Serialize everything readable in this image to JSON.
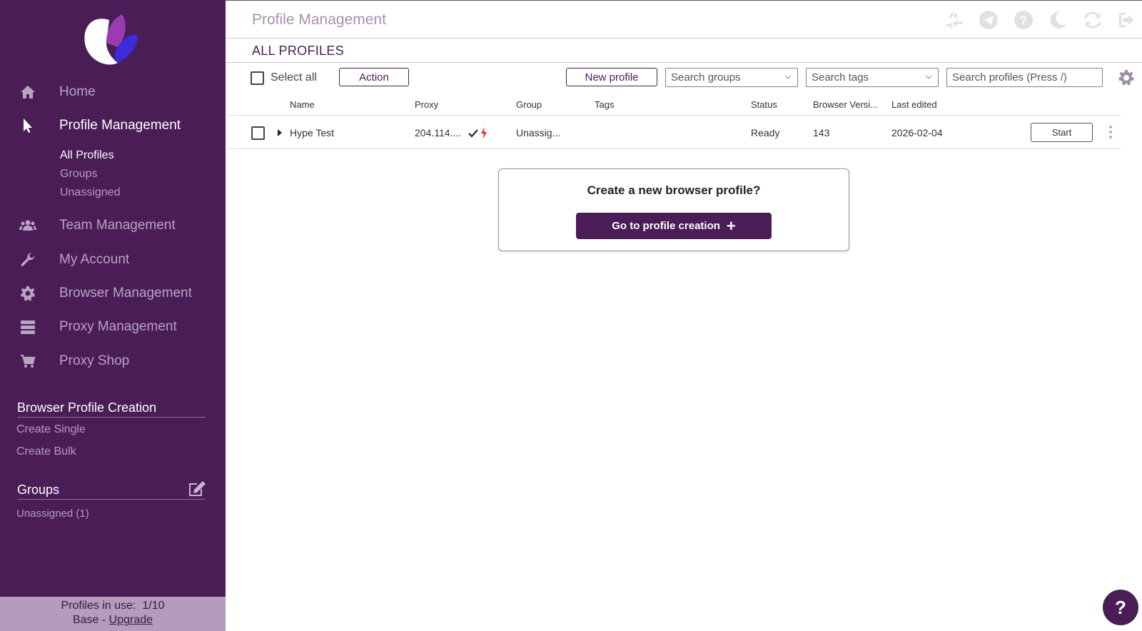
{
  "sidebar": {
    "nav": [
      {
        "label": "Home",
        "icon": "home-icon"
      },
      {
        "label": "Profile Management",
        "icon": "cursor-icon"
      },
      {
        "label": "Team Management",
        "icon": "team-icon"
      },
      {
        "label": "My Account",
        "icon": "wrench-icon"
      },
      {
        "label": "Browser Management",
        "icon": "gear-icon"
      },
      {
        "label": "Proxy Management",
        "icon": "server-icon"
      },
      {
        "label": "Proxy Shop",
        "icon": "cart-icon"
      }
    ],
    "profile_sub": [
      "All Profiles",
      "Groups",
      "Unassigned"
    ],
    "creation_title": "Browser Profile Creation",
    "creation_links": [
      "Create Single",
      "Create Bulk"
    ],
    "groups_title": "Groups",
    "groups_items": [
      "Unassigned (1)"
    ],
    "usage_label": "Profiles in use:",
    "usage_value": "1/10",
    "plan": "Base",
    "plan_sep": " - ",
    "upgrade": "Upgrade"
  },
  "header": {
    "title": "Profile Management",
    "icons": [
      "recycle-icon",
      "telegram-icon",
      "help-icon",
      "moon-icon",
      "refresh-icon",
      "logout-icon"
    ]
  },
  "subheader": {
    "title": "ALL PROFILES"
  },
  "toolbar": {
    "select_all": "Select all",
    "action": "Action",
    "new_profile": "New profile",
    "search_groups": "Search groups",
    "search_tags": "Search tags",
    "search_profiles_placeholder": "Search profiles (Press /)"
  },
  "table": {
    "columns": [
      "Name",
      "Proxy",
      "Group",
      "Tags",
      "Status",
      "Browser Versi...",
      "Last edited"
    ],
    "rows": [
      {
        "name": "Hype Test",
        "proxy": "204.114....",
        "group": "Unassig...",
        "tags": "",
        "status": "Ready",
        "browser_version": "143",
        "last_edited": "2026-02-04",
        "action": "Start"
      }
    ]
  },
  "create_card": {
    "title": "Create a new browser profile?",
    "button": "Go to profile creation",
    "button_icon": "+"
  },
  "help_fab": "?",
  "colors": {
    "brand": "#4a1d57",
    "sidebar_text": "#b9a4c2",
    "proxy_ok": "#333333",
    "proxy_bolt": "#e8202b"
  }
}
